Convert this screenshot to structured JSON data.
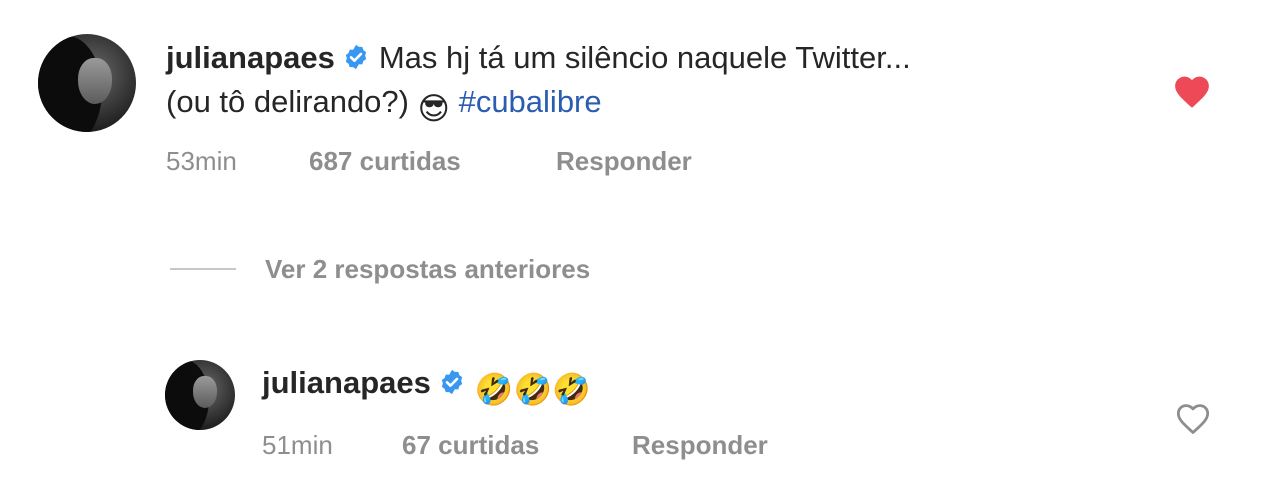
{
  "comments": [
    {
      "username": "julianapaes",
      "verified": true,
      "text_line1": "Mas hj tá um silêncio naquele Twitter...",
      "text_line2": "(ou tô delirando?)",
      "emoji": "😎",
      "hashtag": "#cubalibre",
      "time": "53min",
      "likes": "687 curtidas",
      "reply_label": "Responder",
      "liked": true,
      "like_icon": "heart-filled-icon"
    },
    {
      "username": "julianapaes",
      "verified": true,
      "emojis": "🤣🤣🤣",
      "time": "51min",
      "likes": "67 curtidas",
      "reply_label": "Responder",
      "liked": false,
      "like_icon": "heart-outline-icon"
    }
  ],
  "view_replies_label": "Ver 2 respostas anteriores",
  "colors": {
    "text": "#262626",
    "secondary": "#8e8e8e",
    "hashtag": "#2a5db0",
    "verified": "#3897f0",
    "like": "#ed4956"
  }
}
